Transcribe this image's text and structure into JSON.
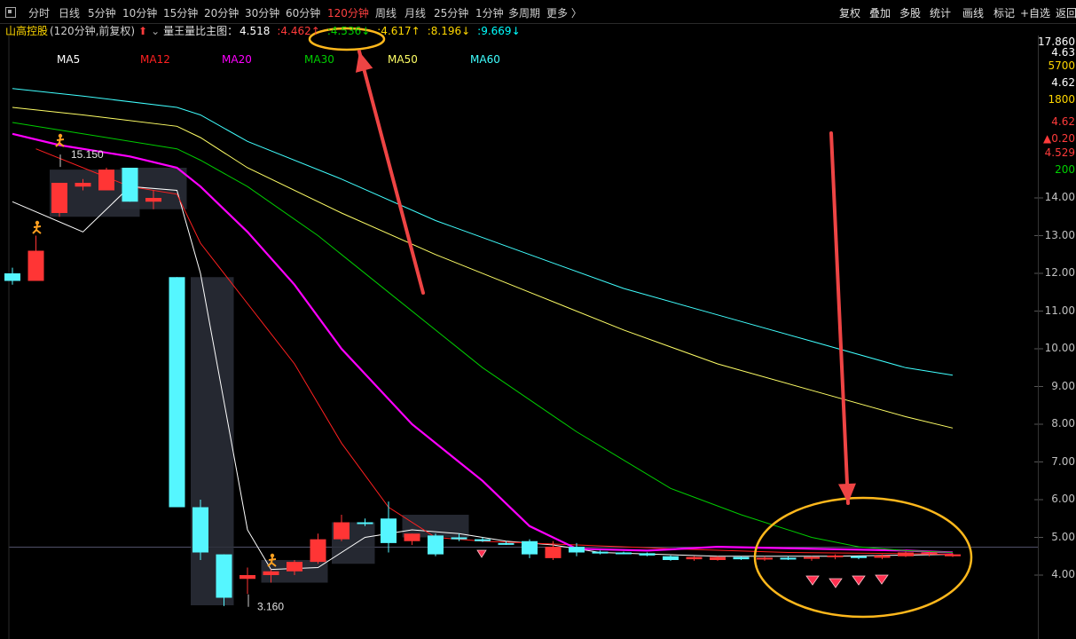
{
  "toolbar": {
    "periods": [
      "分时",
      "日线",
      "5分钟",
      "10分钟",
      "15分钟",
      "20分钟",
      "30分钟",
      "60分钟",
      "120分钟",
      "周线",
      "月线",
      "25分钟",
      "1分钟",
      "多周期",
      "更多 〉"
    ],
    "active_period": "120分钟",
    "right_items": [
      "复权",
      "叠加",
      "多股",
      "统计",
      "画线",
      "标记",
      "+自选",
      "返回"
    ]
  },
  "info": {
    "stock_name": "山高控股",
    "period_label": "(120分钟,前复权)",
    "indicator": "量王量比主图：",
    "values": [
      {
        "text": "4.518",
        "arrow": "",
        "color": "#ffffff"
      },
      {
        "text": "4.462",
        "arrow": "↑",
        "color": "#ff3b3b"
      },
      {
        "text": "4.536",
        "arrow": "↓",
        "color": "#00d000"
      },
      {
        "text": "4.617",
        "arrow": "↑",
        "color": "#ffd700"
      },
      {
        "text": "8.196",
        "arrow": "↓",
        "color": "#ffd700"
      },
      {
        "text": "9.669",
        "arrow": "↓",
        "color": "#00ffff"
      }
    ]
  },
  "right_panel": [
    {
      "text": "17.860",
      "color": "#ffffff"
    },
    {
      "text": "4.63",
      "color": "#ffffff"
    },
    {
      "text": "5700",
      "color": "#ffd700"
    },
    {
      "text": "4.62",
      "color": "#ffffff"
    },
    {
      "text": "1800",
      "color": "#ffd700"
    },
    {
      "text": "4.62",
      "color": "#ff3b3b"
    },
    {
      "text": "▲0.20",
      "color": "#ff3b3b"
    },
    {
      "text": "4.529",
      "color": "#ff3b3b"
    },
    {
      "text": "200",
      "color": "#00d000"
    }
  ],
  "colors": {
    "up": "#ff3535",
    "down": "#55f6ff",
    "ma5": "#ffffff",
    "ma12": "#ff2020",
    "ma20": "#ff00ff",
    "ma30": "#00cc00",
    "ma50": "#ffff66",
    "ma60": "#40ffff",
    "annotation": "#ee4444",
    "highlight": "#ffb81c"
  },
  "chart_data": {
    "type": "candlestick",
    "y_ticks": [
      14,
      13,
      12,
      11,
      10,
      9,
      8,
      7,
      6,
      5,
      4
    ],
    "y_tick_labels": [
      "14.00",
      "13.00",
      "12.00",
      "11.00",
      "10.00",
      "9.00",
      "8.00",
      "7.00",
      "6.00",
      "5.00",
      "4.00"
    ],
    "ylim": [
      3.0,
      16.7
    ],
    "last_price": 4.55,
    "annotations": [
      {
        "text": "15.150",
        "value": 15.15
      },
      {
        "text": "3.160",
        "value": 3.16
      }
    ],
    "ma_labels": [
      "MA5",
      "MA12",
      "MA20",
      "MA30",
      "MA50",
      "MA60"
    ],
    "candles": [
      {
        "o": 12.0,
        "h": 12.15,
        "l": 11.7,
        "c": 11.8
      },
      {
        "o": 11.8,
        "h": 13.0,
        "l": 11.8,
        "c": 12.6
      },
      {
        "o": 13.6,
        "h": 14.4,
        "l": 13.5,
        "c": 14.4
      },
      {
        "o": 14.3,
        "h": 14.5,
        "l": 14.2,
        "c": 14.4
      },
      {
        "o": 14.2,
        "h": 14.8,
        "l": 14.2,
        "c": 14.75
      },
      {
        "o": 14.8,
        "h": 14.8,
        "l": 13.9,
        "c": 13.9
      },
      {
        "o": 13.9,
        "h": 14.2,
        "l": 13.7,
        "c": 14.0
      },
      {
        "o": 11.9,
        "h": 11.9,
        "l": 5.8,
        "c": 5.8
      },
      {
        "o": 5.8,
        "h": 6.0,
        "l": 4.4,
        "c": 4.6
      },
      {
        "o": 4.55,
        "h": 4.55,
        "l": 3.18,
        "c": 3.4
      },
      {
        "o": 3.9,
        "h": 4.2,
        "l": 3.5,
        "c": 4.0
      },
      {
        "o": 4.0,
        "h": 4.15,
        "l": 3.8,
        "c": 4.1
      },
      {
        "o": 4.1,
        "h": 4.4,
        "l": 4.0,
        "c": 4.35
      },
      {
        "o": 4.35,
        "h": 5.1,
        "l": 4.3,
        "c": 4.95
      },
      {
        "o": 4.95,
        "h": 5.6,
        "l": 4.9,
        "c": 5.4
      },
      {
        "o": 5.4,
        "h": 5.5,
        "l": 5.3,
        "c": 5.38
      },
      {
        "o": 5.5,
        "h": 5.95,
        "l": 4.6,
        "c": 4.85
      },
      {
        "o": 4.9,
        "h": 5.1,
        "l": 4.8,
        "c": 5.1
      },
      {
        "o": 5.05,
        "h": 5.1,
        "l": 4.5,
        "c": 4.55
      },
      {
        "o": 5.0,
        "h": 5.1,
        "l": 4.9,
        "c": 4.95
      },
      {
        "o": 4.95,
        "h": 5.0,
        "l": 4.88,
        "c": 4.9
      },
      {
        "o": 4.85,
        "h": 4.9,
        "l": 4.8,
        "c": 4.82
      },
      {
        "o": 4.9,
        "h": 4.95,
        "l": 4.45,
        "c": 4.55
      },
      {
        "o": 4.45,
        "h": 4.9,
        "l": 4.4,
        "c": 4.75
      },
      {
        "o": 4.75,
        "h": 4.85,
        "l": 4.5,
        "c": 4.6
      },
      {
        "o": 4.62,
        "h": 4.65,
        "l": 4.55,
        "c": 4.6
      },
      {
        "o": 4.6,
        "h": 4.62,
        "l": 4.56,
        "c": 4.58
      },
      {
        "o": 4.58,
        "h": 4.6,
        "l": 4.5,
        "c": 4.52
      },
      {
        "o": 4.5,
        "h": 4.52,
        "l": 4.38,
        "c": 4.4
      },
      {
        "o": 4.42,
        "h": 4.5,
        "l": 4.38,
        "c": 4.48
      },
      {
        "o": 4.4,
        "h": 4.5,
        "l": 4.38,
        "c": 4.48
      },
      {
        "o": 4.48,
        "h": 4.5,
        "l": 4.4,
        "c": 4.42
      },
      {
        "o": 4.42,
        "h": 4.5,
        "l": 4.38,
        "c": 4.46
      },
      {
        "o": 4.46,
        "h": 4.5,
        "l": 4.4,
        "c": 4.44
      },
      {
        "o": 4.46,
        "h": 4.5,
        "l": 4.38,
        "c": 4.48
      },
      {
        "o": 4.48,
        "h": 4.55,
        "l": 4.42,
        "c": 4.52
      },
      {
        "o": 4.5,
        "h": 4.52,
        "l": 4.42,
        "c": 4.46
      },
      {
        "o": 4.46,
        "h": 4.55,
        "l": 4.42,
        "c": 4.52
      },
      {
        "o": 4.5,
        "h": 4.62,
        "l": 4.48,
        "c": 4.6
      },
      {
        "o": 4.55,
        "h": 4.62,
        "l": 4.5,
        "c": 4.6
      },
      {
        "o": 4.5,
        "h": 4.58,
        "l": 4.48,
        "c": 4.55
      }
    ],
    "ma_series": [
      {
        "name": "MA5",
        "color": "#ffffff",
        "points": [
          [
            0,
            13.9
          ],
          [
            3,
            13.1
          ],
          [
            5,
            14.3
          ],
          [
            7,
            14.2
          ],
          [
            8,
            12.0
          ],
          [
            10,
            5.2
          ],
          [
            11,
            4.15
          ],
          [
            13,
            4.2
          ],
          [
            15,
            5.0
          ],
          [
            17,
            5.2
          ],
          [
            19,
            5.1
          ],
          [
            21,
            4.9
          ],
          [
            23,
            4.8
          ],
          [
            25,
            4.6
          ],
          [
            30,
            4.5
          ],
          [
            35,
            4.5
          ],
          [
            40,
            4.55
          ]
        ]
      },
      {
        "name": "MA12",
        "color": "#ff2020",
        "points": [
          [
            1,
            15.3
          ],
          [
            5,
            14.3
          ],
          [
            7,
            14.1
          ],
          [
            8,
            12.8
          ],
          [
            10,
            11.2
          ],
          [
            12,
            9.6
          ],
          [
            14,
            7.5
          ],
          [
            16,
            5.8
          ],
          [
            18,
            5.0
          ],
          [
            20,
            4.9
          ],
          [
            22,
            4.85
          ],
          [
            24,
            4.8
          ],
          [
            28,
            4.7
          ],
          [
            33,
            4.6
          ],
          [
            38,
            4.57
          ],
          [
            40,
            4.55
          ]
        ]
      },
      {
        "name": "MA20",
        "color": "#ff00ff",
        "points": [
          [
            0,
            15.7
          ],
          [
            2,
            15.4
          ],
          [
            5,
            15.1
          ],
          [
            7,
            14.8
          ],
          [
            8,
            14.3
          ],
          [
            10,
            13.1
          ],
          [
            12,
            11.7
          ],
          [
            14,
            10.0
          ],
          [
            17,
            8.0
          ],
          [
            20,
            6.5
          ],
          [
            22,
            5.3
          ],
          [
            24,
            4.7
          ],
          [
            27,
            4.65
          ],
          [
            30,
            4.75
          ],
          [
            34,
            4.7
          ],
          [
            38,
            4.65
          ],
          [
            40,
            4.6
          ]
        ]
      },
      {
        "name": "MA30",
        "color": "#00cc00",
        "points": [
          [
            0,
            16.0
          ],
          [
            3,
            15.7
          ],
          [
            7,
            15.3
          ],
          [
            8,
            15.0
          ],
          [
            10,
            14.3
          ],
          [
            13,
            13.0
          ],
          [
            16,
            11.5
          ],
          [
            20,
            9.5
          ],
          [
            24,
            7.8
          ],
          [
            28,
            6.3
          ],
          [
            31,
            5.6
          ],
          [
            34,
            5.0
          ],
          [
            36,
            4.75
          ],
          [
            38,
            4.65
          ],
          [
            40,
            4.6
          ]
        ]
      },
      {
        "name": "MA50",
        "color": "#ffff66",
        "points": [
          [
            0,
            16.4
          ],
          [
            3,
            16.2
          ],
          [
            7,
            15.9
          ],
          [
            8,
            15.6
          ],
          [
            10,
            14.8
          ],
          [
            14,
            13.6
          ],
          [
            18,
            12.5
          ],
          [
            22,
            11.5
          ],
          [
            26,
            10.5
          ],
          [
            30,
            9.6
          ],
          [
            34,
            8.9
          ],
          [
            38,
            8.2
          ],
          [
            40,
            7.9
          ]
        ]
      },
      {
        "name": "MA60",
        "color": "#40ffff",
        "points": [
          [
            0,
            16.9
          ],
          [
            3,
            16.7
          ],
          [
            7,
            16.4
          ],
          [
            8,
            16.2
          ],
          [
            10,
            15.5
          ],
          [
            14,
            14.5
          ],
          [
            18,
            13.4
          ],
          [
            22,
            12.5
          ],
          [
            26,
            11.6
          ],
          [
            30,
            10.9
          ],
          [
            34,
            10.2
          ],
          [
            38,
            9.5
          ],
          [
            40,
            9.3
          ]
        ]
      }
    ]
  }
}
